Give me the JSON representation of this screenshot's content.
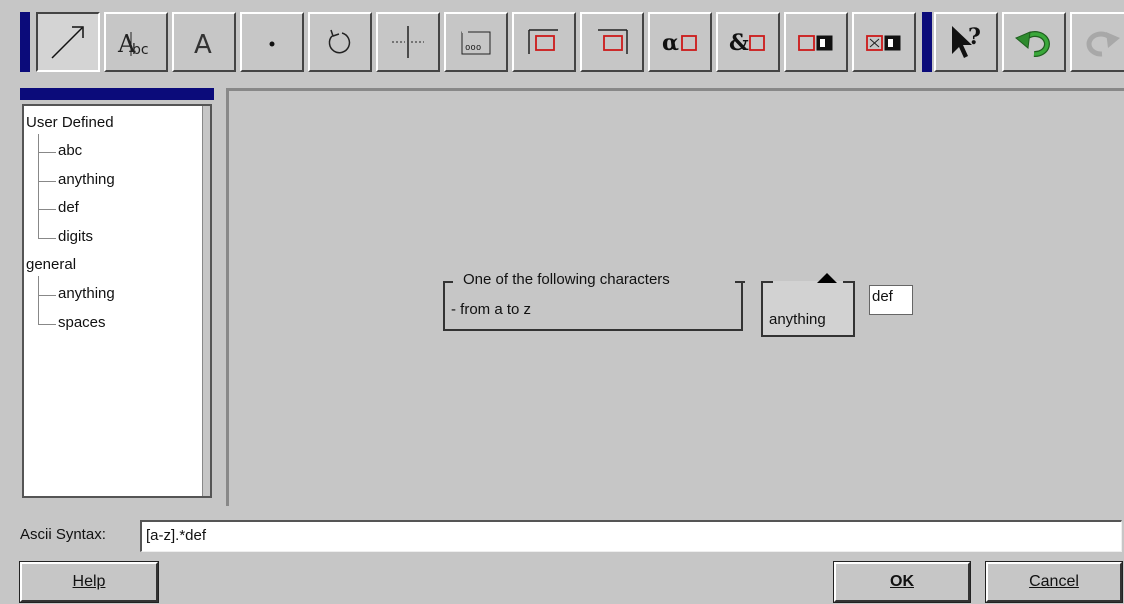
{
  "toolbar": {
    "buttons": [
      {
        "name": "draw-arrow-tool",
        "icon": "diagonal-arrow-icon"
      },
      {
        "name": "character-set-tool",
        "icon": "abc-char-icon"
      },
      {
        "name": "text-tool",
        "icon": "letter-a-icon"
      },
      {
        "name": "any-char-tool",
        "icon": "dot-icon"
      },
      {
        "name": "repeat-tool",
        "icon": "loop-arrow-icon"
      },
      {
        "name": "alternative-tool",
        "icon": "split-bar-icon"
      },
      {
        "name": "group-tool",
        "icon": "group-box-icon"
      },
      {
        "name": "begin-line-tool",
        "icon": "box-left-icon"
      },
      {
        "name": "end-line-tool",
        "icon": "box-right-icon"
      },
      {
        "name": "alpha-tool",
        "icon": "alpha-box-icon"
      },
      {
        "name": "ampersand-tool",
        "icon": "ampersand-box-icon"
      },
      {
        "name": "negated-set-tool",
        "icon": "filled-box-icon"
      },
      {
        "name": "exclusion-tool",
        "icon": "cross-box-icon"
      },
      {
        "name": "whats-this-tool",
        "icon": "whats-this-icon"
      },
      {
        "name": "undo-tool",
        "icon": "undo-icon"
      },
      {
        "name": "redo-tool",
        "icon": "redo-icon"
      }
    ],
    "alpha_glyph": "α",
    "amp_glyph": "&",
    "help_glyph": "?"
  },
  "tree": {
    "groups": [
      {
        "label": "User Defined",
        "items": [
          "abc",
          "anything",
          "def",
          "digits"
        ]
      },
      {
        "label": "general",
        "items": [
          "anything",
          "spaces"
        ]
      }
    ]
  },
  "canvas": {
    "char_group": {
      "title": "One of the following characters",
      "range": "- from a to z"
    },
    "repeat": {
      "label": "anything"
    },
    "literal": {
      "text": "def"
    }
  },
  "syntax": {
    "label": "Ascii Syntax:",
    "value": "[a-z].*def"
  },
  "buttons": {
    "help": "Help",
    "ok": "OK",
    "cancel": "Cancel"
  },
  "colors": {
    "title_bar": "#0b0b7a",
    "background": "#c6c6c6",
    "accent_red": "#cc1a1a",
    "undo_green": "#2e8b2e"
  }
}
